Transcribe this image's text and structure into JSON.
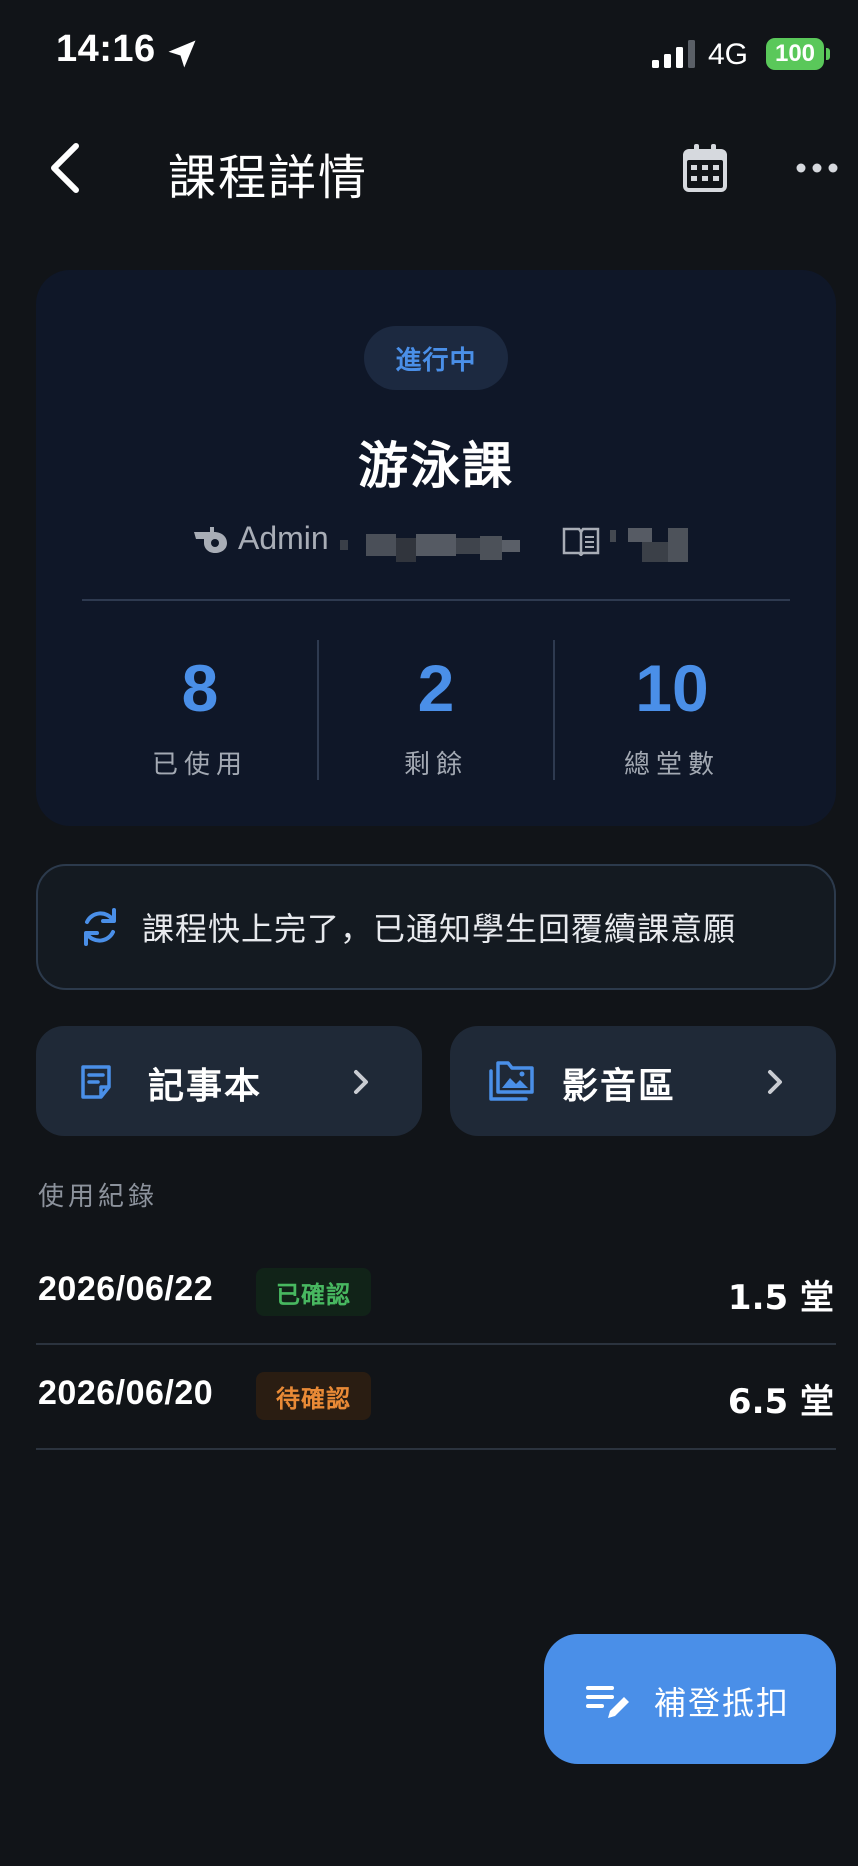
{
  "status_bar": {
    "time": "14:16",
    "network": "4G",
    "battery": "100"
  },
  "header": {
    "title": "課程詳情"
  },
  "course": {
    "status": "進行中",
    "name": "游泳課",
    "instructor": "Admin"
  },
  "stats": [
    {
      "value": "8",
      "label": "已使用"
    },
    {
      "value": "2",
      "label": "剩餘"
    },
    {
      "value": "10",
      "label": "總堂數"
    }
  ],
  "notice": {
    "text": "課程快上完了，已通知學生回覆續課意願"
  },
  "actions": [
    {
      "label": "記事本",
      "icon": "notepad-icon"
    },
    {
      "label": "影音區",
      "icon": "media-folder-icon"
    }
  ],
  "records": {
    "title": "使用紀錄",
    "items": [
      {
        "date": "2026/06/22",
        "status": "已確認",
        "amount": "1.5 堂"
      },
      {
        "date": "2026/06/20",
        "status": "待確認",
        "amount": "6.5 堂"
      }
    ]
  },
  "fab": {
    "label": "補登抵扣"
  },
  "colors": {
    "accent": "#4a8fe8",
    "confirmed": "#48b860",
    "pending": "#e98a36",
    "battery": "#5ac85a"
  }
}
